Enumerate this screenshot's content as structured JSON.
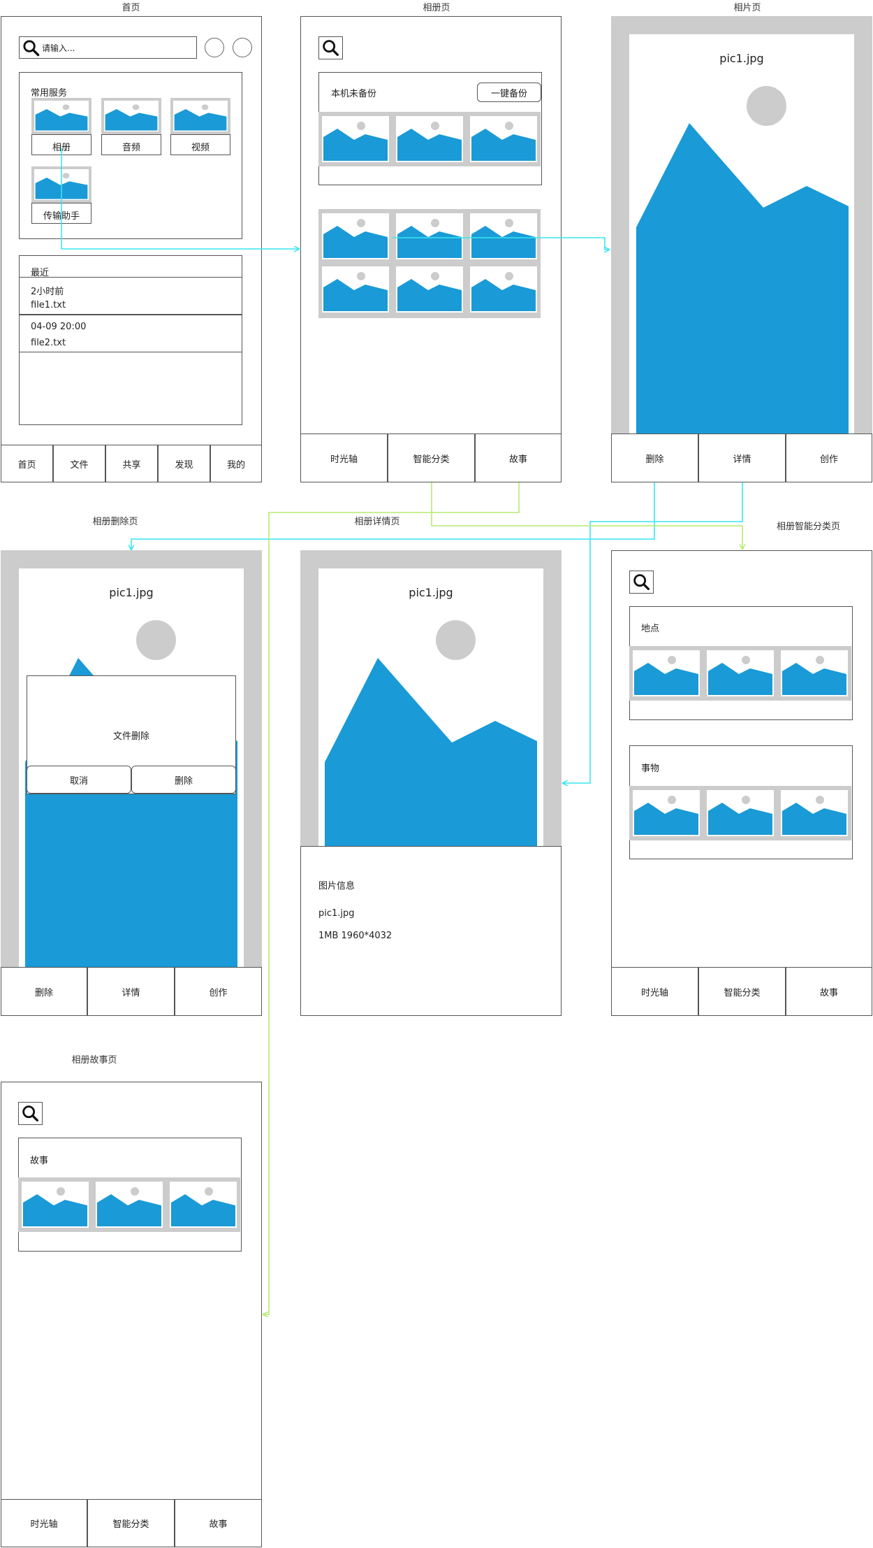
{
  "frames": {
    "home": {
      "title": "首页",
      "search_placeholder": "请输入...",
      "services_title": "常用服务",
      "services": [
        "相册",
        "音频",
        "视频",
        "传输助手"
      ],
      "recent_title": "最近",
      "recent": [
        {
          "time": "2小时前",
          "file": "file1.txt"
        },
        {
          "time": "04-09 20:00",
          "file": "file2.txt"
        }
      ],
      "nav": [
        "首页",
        "文件",
        "共享",
        "发现",
        "我的"
      ]
    },
    "album": {
      "title": "相册页",
      "unbacked_label": "本机未备份",
      "backup_button": "一键备份",
      "nav": [
        "时光轴",
        "智能分类",
        "故事"
      ]
    },
    "photo": {
      "title": "相片页",
      "filename": "pic1.jpg",
      "nav": [
        "删除",
        "详情",
        "创作"
      ]
    },
    "delete": {
      "title": "相册删除页",
      "filename": "pic1.jpg",
      "dialog_title": "文件删除",
      "cancel_button": "取消",
      "delete_button": "删除",
      "nav": [
        "删除",
        "详情",
        "创作"
      ]
    },
    "detail": {
      "title": "相册详情页",
      "filename": "pic1.jpg",
      "info_title": "图片信息",
      "info_name": "pic1.jpg",
      "info_meta": "1MB 1960*4032"
    },
    "smart": {
      "title": "相册智能分类页",
      "groups": [
        "地点",
        "事物"
      ],
      "nav": [
        "时光轴",
        "智能分类",
        "故事"
      ]
    },
    "story": {
      "title": "相册故事页",
      "group": "故事",
      "nav": [
        "时光轴",
        "智能分类",
        "故事"
      ]
    }
  },
  "colors": {
    "image_blue": "#1a9ad6",
    "placeholder_gray": "#cccccc",
    "link_cyan": "#39e6f0",
    "link_green": "#b6ec6e",
    "border": "#555555"
  },
  "icons": [
    "search-icon",
    "image-placeholder-icon",
    "circle-icon"
  ]
}
